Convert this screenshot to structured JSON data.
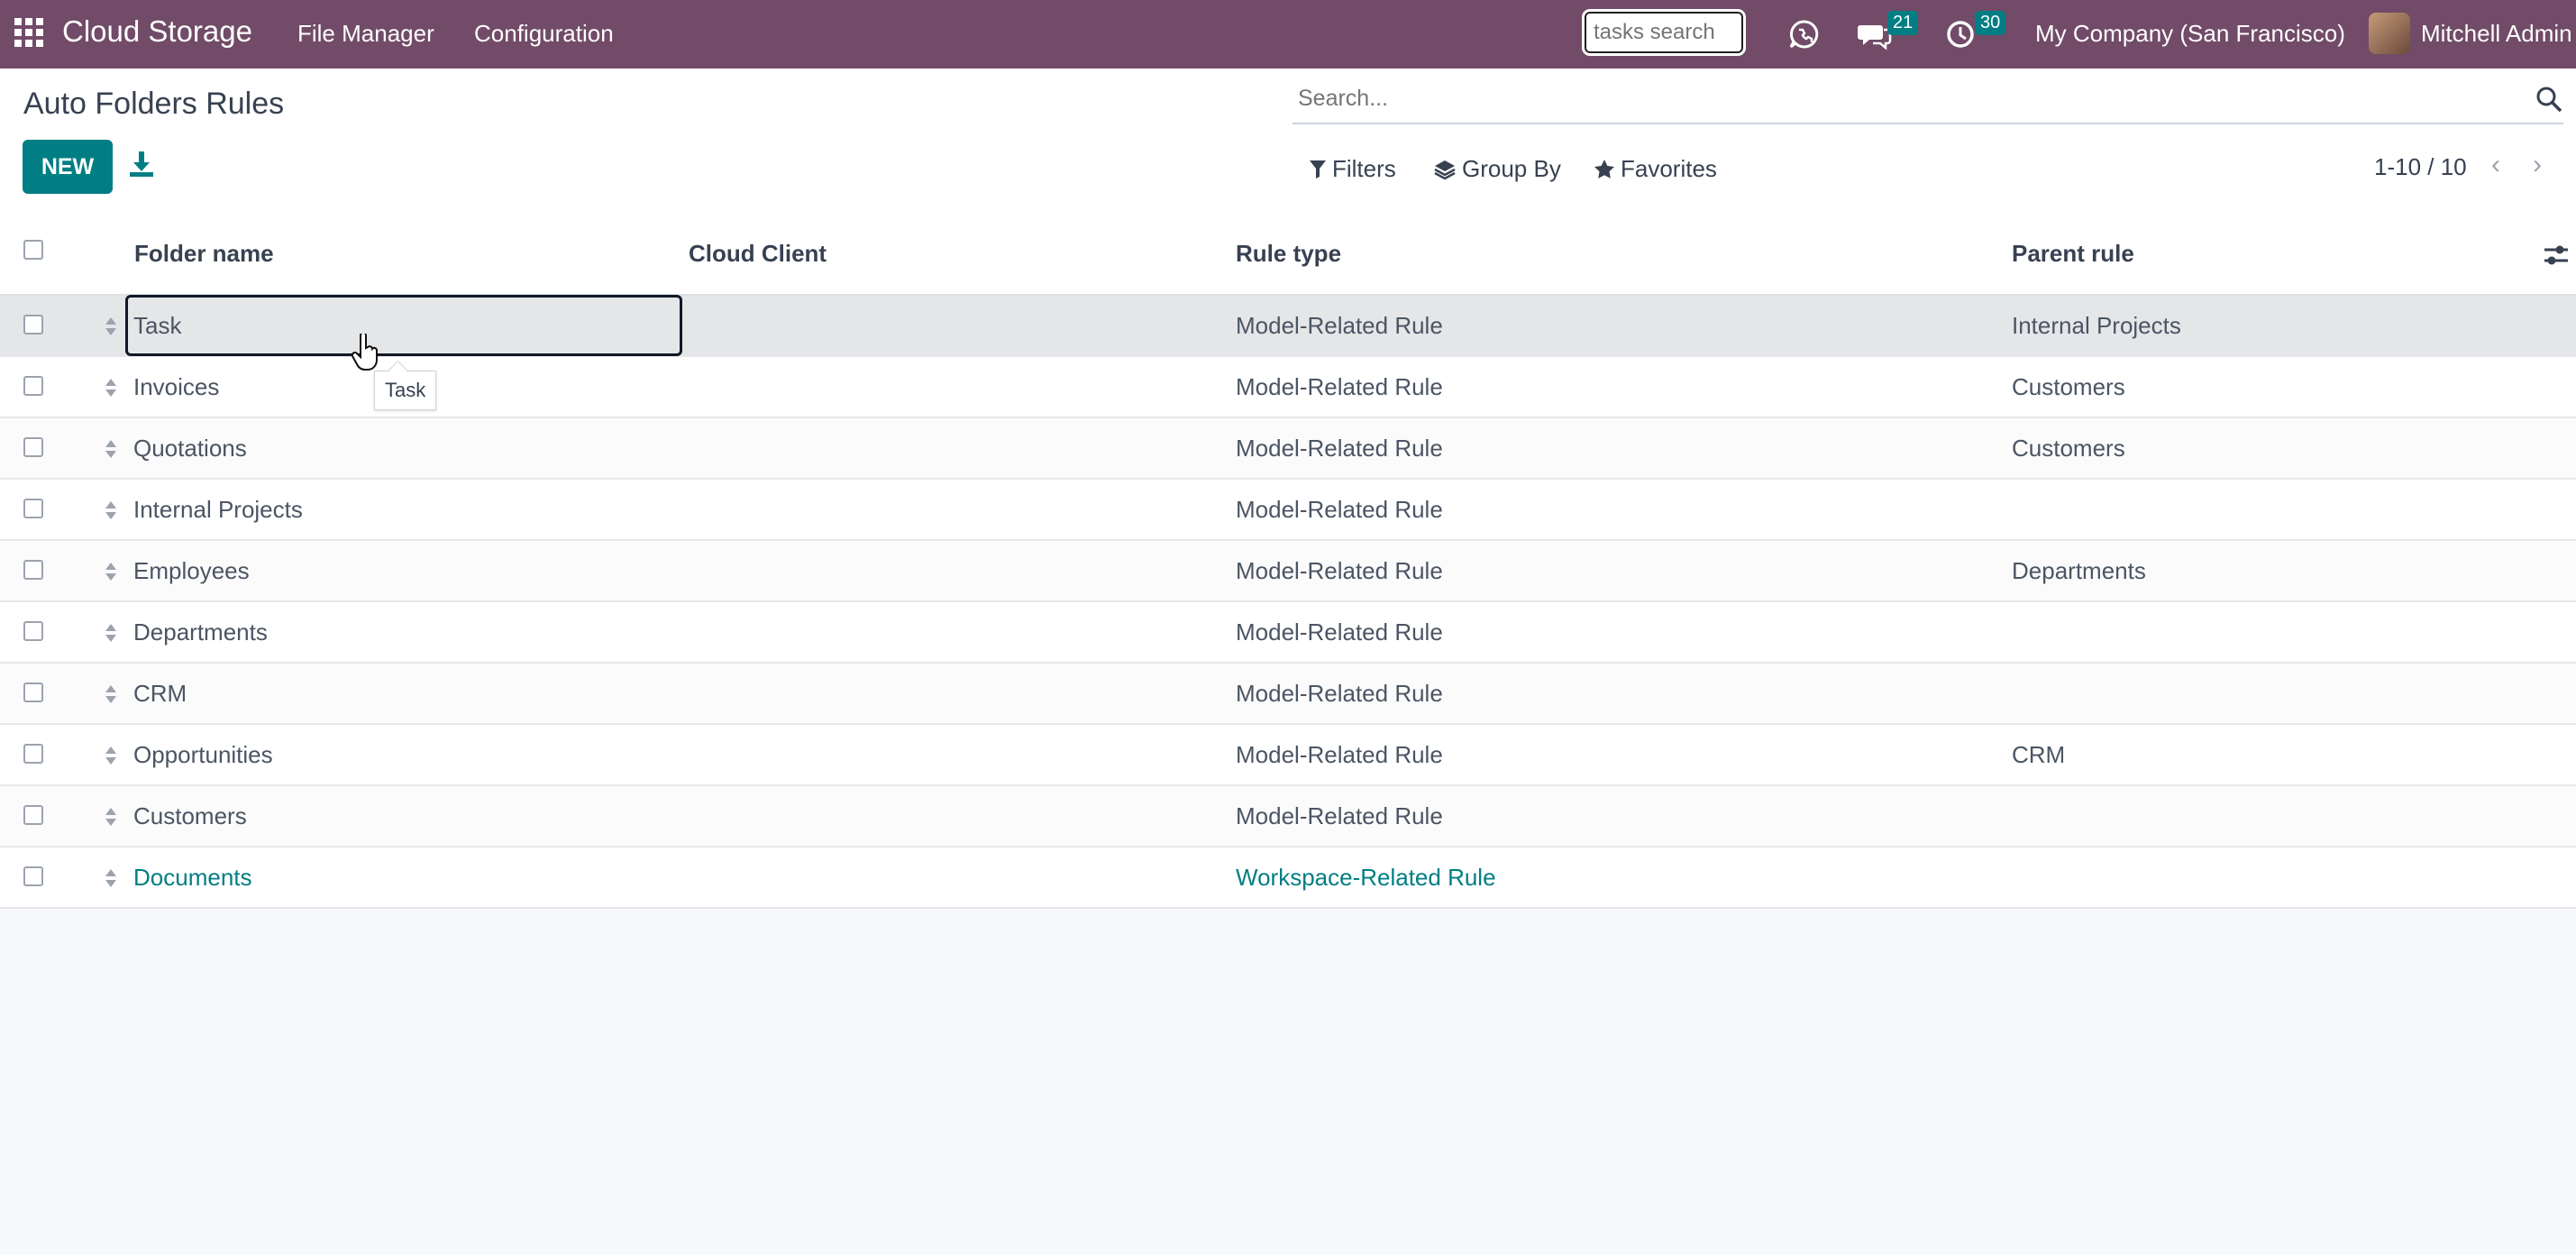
{
  "topbar": {
    "app_title": "Cloud Storage",
    "menu": [
      "File Manager",
      "Configuration"
    ],
    "tasks_search_placeholder": "tasks search",
    "messages_badge": "21",
    "activities_badge": "30",
    "company": "My Company (San Francisco)",
    "user": "Mitchell Admin"
  },
  "page": {
    "title": "Auto Folders Rules",
    "new_label": "NEW",
    "search_placeholder": "Search...",
    "filters_label": "Filters",
    "groupby_label": "Group By",
    "favorites_label": "Favorites",
    "pager": "1-10 / 10"
  },
  "table": {
    "columns": [
      "Folder name",
      "Cloud Client",
      "Rule type",
      "Parent rule"
    ],
    "rows": [
      {
        "folder": "Task",
        "client": "",
        "rule_type": "Model-Related Rule",
        "parent": "Internal Projects"
      },
      {
        "folder": "Invoices",
        "client": "",
        "rule_type": "Model-Related Rule",
        "parent": "Customers"
      },
      {
        "folder": "Quotations",
        "client": "",
        "rule_type": "Model-Related Rule",
        "parent": "Customers"
      },
      {
        "folder": "Internal Projects",
        "client": "",
        "rule_type": "Model-Related Rule",
        "parent": ""
      },
      {
        "folder": "Employees",
        "client": "",
        "rule_type": "Model-Related Rule",
        "parent": "Departments"
      },
      {
        "folder": "Departments",
        "client": "",
        "rule_type": "Model-Related Rule",
        "parent": ""
      },
      {
        "folder": "CRM",
        "client": "",
        "rule_type": "Model-Related Rule",
        "parent": ""
      },
      {
        "folder": "Opportunities",
        "client": "",
        "rule_type": "Model-Related Rule",
        "parent": "CRM"
      },
      {
        "folder": "Customers",
        "client": "",
        "rule_type": "Model-Related Rule",
        "parent": ""
      },
      {
        "folder": "Documents",
        "client": "",
        "rule_type": "Workspace-Related Rule",
        "parent": ""
      }
    ],
    "tooltip": "Task"
  },
  "colors": {
    "brand": "#714B67",
    "accent": "#017e84"
  }
}
